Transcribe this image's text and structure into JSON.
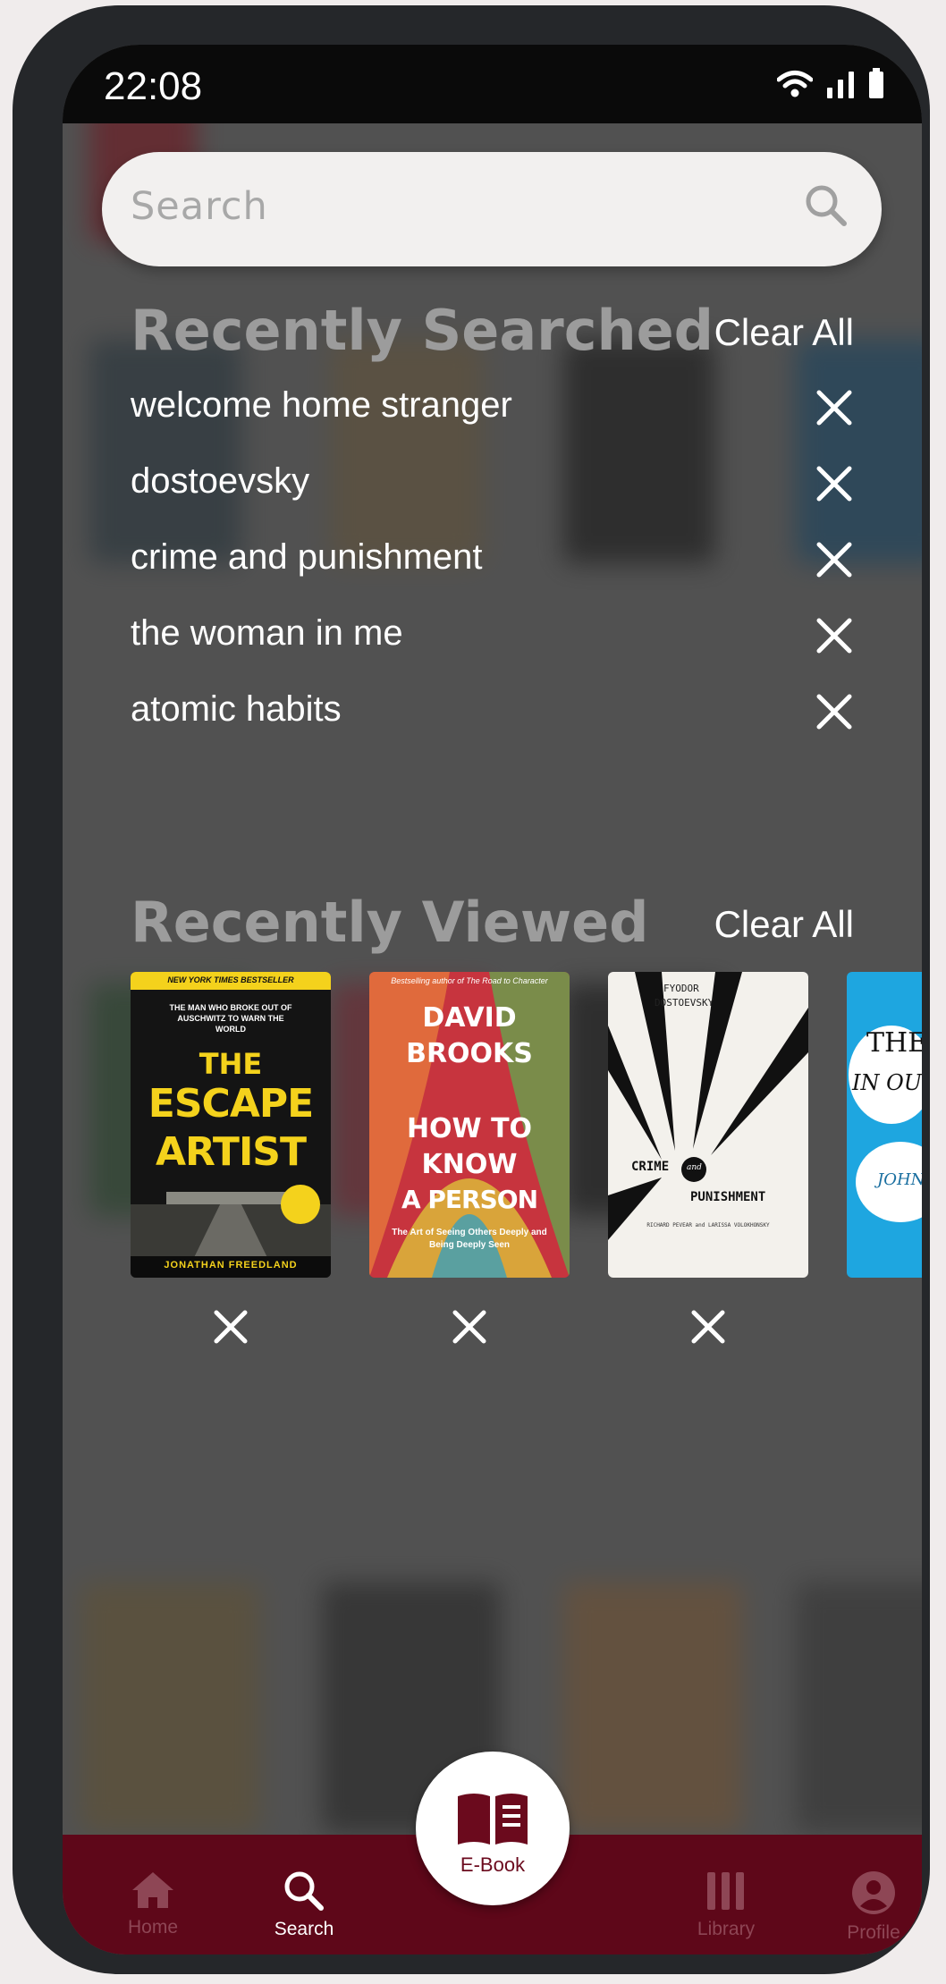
{
  "status": {
    "time": "22:08"
  },
  "search": {
    "placeholder": "Search"
  },
  "recently_searched": {
    "title": "Recently Searched",
    "clear_label": "Clear All",
    "items": [
      "welcome home stranger",
      "dostoevsky",
      "crime and punishment",
      "the woman in me",
      "atomic habits"
    ]
  },
  "recently_viewed": {
    "title": "Recently Viewed",
    "clear_label": "Clear All",
    "books": [
      {
        "banner": "NEW YORK TIMES BESTSELLER",
        "tagline": "THE MAN WHO BROKE OUT OF AUSCHWITZ TO WARN THE WORLD",
        "title_line1": "THE",
        "title_line2": "ESCAPE",
        "title_line3": "ARTIST",
        "author": "JONATHAN FREEDLAND"
      },
      {
        "banner": "Bestselling author of The Road to Character",
        "author_line1": "DAVID",
        "author_line2": "BROOKS",
        "title_line1": "HOW TO",
        "title_line2": "KNOW",
        "title_line3": "A PERSON",
        "subtitle": "The Art of Seeing Others Deeply and Being Deeply Seen"
      },
      {
        "author_line1": "FYODOR",
        "author_line2": "DOSTOEVSKY",
        "title_line1": "CRIME",
        "title_and": "and",
        "title_line2": "PUNISHMENT",
        "translators": "RICHARD PEVEAR and LARISSA VOLOKHONSKY"
      },
      {
        "title_line1": "THE",
        "title_line2": "IN OU",
        "author": "JOHN"
      }
    ]
  },
  "nav": {
    "items": [
      {
        "label": "Home",
        "icon": "home-icon"
      },
      {
        "label": "Search",
        "icon": "search-icon"
      },
      {
        "label": "Library",
        "icon": "library-icon"
      },
      {
        "label": "Profile",
        "icon": "profile-icon"
      }
    ],
    "center_label": "E-Book",
    "active": "Search"
  },
  "colors": {
    "nav_background": "#5e0719",
    "accent": "#6b0a1d",
    "title_gray": "#9c9c9c"
  }
}
